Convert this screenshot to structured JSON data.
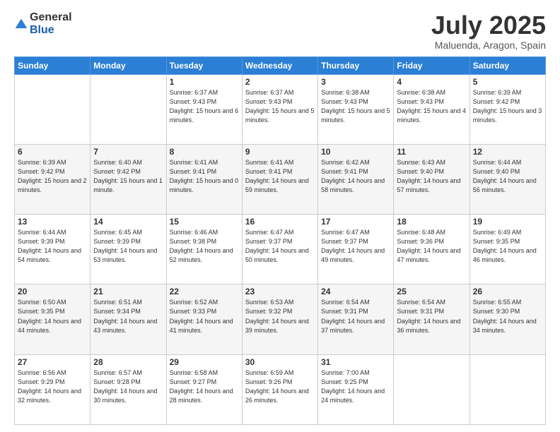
{
  "logo": {
    "general": "General",
    "blue": "Blue"
  },
  "header": {
    "month": "July 2025",
    "location": "Maluenda, Aragon, Spain"
  },
  "weekdays": [
    "Sunday",
    "Monday",
    "Tuesday",
    "Wednesday",
    "Thursday",
    "Friday",
    "Saturday"
  ],
  "weeks": [
    [
      {
        "day": "",
        "content": ""
      },
      {
        "day": "",
        "content": ""
      },
      {
        "day": "1",
        "sunrise": "Sunrise: 6:37 AM",
        "sunset": "Sunset: 9:43 PM",
        "daylight": "Daylight: 15 hours and 6 minutes."
      },
      {
        "day": "2",
        "sunrise": "Sunrise: 6:37 AM",
        "sunset": "Sunset: 9:43 PM",
        "daylight": "Daylight: 15 hours and 5 minutes."
      },
      {
        "day": "3",
        "sunrise": "Sunrise: 6:38 AM",
        "sunset": "Sunset: 9:43 PM",
        "daylight": "Daylight: 15 hours and 5 minutes."
      },
      {
        "day": "4",
        "sunrise": "Sunrise: 6:38 AM",
        "sunset": "Sunset: 9:43 PM",
        "daylight": "Daylight: 15 hours and 4 minutes."
      },
      {
        "day": "5",
        "sunrise": "Sunrise: 6:39 AM",
        "sunset": "Sunset: 9:42 PM",
        "daylight": "Daylight: 15 hours and 3 minutes."
      }
    ],
    [
      {
        "day": "6",
        "sunrise": "Sunrise: 6:39 AM",
        "sunset": "Sunset: 9:42 PM",
        "daylight": "Daylight: 15 hours and 2 minutes."
      },
      {
        "day": "7",
        "sunrise": "Sunrise: 6:40 AM",
        "sunset": "Sunset: 9:42 PM",
        "daylight": "Daylight: 15 hours and 1 minute."
      },
      {
        "day": "8",
        "sunrise": "Sunrise: 6:41 AM",
        "sunset": "Sunset: 9:41 PM",
        "daylight": "Daylight: 15 hours and 0 minutes."
      },
      {
        "day": "9",
        "sunrise": "Sunrise: 6:41 AM",
        "sunset": "Sunset: 9:41 PM",
        "daylight": "Daylight: 14 hours and 59 minutes."
      },
      {
        "day": "10",
        "sunrise": "Sunrise: 6:42 AM",
        "sunset": "Sunset: 9:41 PM",
        "daylight": "Daylight: 14 hours and 58 minutes."
      },
      {
        "day": "11",
        "sunrise": "Sunrise: 6:43 AM",
        "sunset": "Sunset: 9:40 PM",
        "daylight": "Daylight: 14 hours and 57 minutes."
      },
      {
        "day": "12",
        "sunrise": "Sunrise: 6:44 AM",
        "sunset": "Sunset: 9:40 PM",
        "daylight": "Daylight: 14 hours and 56 minutes."
      }
    ],
    [
      {
        "day": "13",
        "sunrise": "Sunrise: 6:44 AM",
        "sunset": "Sunset: 9:39 PM",
        "daylight": "Daylight: 14 hours and 54 minutes."
      },
      {
        "day": "14",
        "sunrise": "Sunrise: 6:45 AM",
        "sunset": "Sunset: 9:39 PM",
        "daylight": "Daylight: 14 hours and 53 minutes."
      },
      {
        "day": "15",
        "sunrise": "Sunrise: 6:46 AM",
        "sunset": "Sunset: 9:38 PM",
        "daylight": "Daylight: 14 hours and 52 minutes."
      },
      {
        "day": "16",
        "sunrise": "Sunrise: 6:47 AM",
        "sunset": "Sunset: 9:37 PM",
        "daylight": "Daylight: 14 hours and 50 minutes."
      },
      {
        "day": "17",
        "sunrise": "Sunrise: 6:47 AM",
        "sunset": "Sunset: 9:37 PM",
        "daylight": "Daylight: 14 hours and 49 minutes."
      },
      {
        "day": "18",
        "sunrise": "Sunrise: 6:48 AM",
        "sunset": "Sunset: 9:36 PM",
        "daylight": "Daylight: 14 hours and 47 minutes."
      },
      {
        "day": "19",
        "sunrise": "Sunrise: 6:49 AM",
        "sunset": "Sunset: 9:35 PM",
        "daylight": "Daylight: 14 hours and 46 minutes."
      }
    ],
    [
      {
        "day": "20",
        "sunrise": "Sunrise: 6:50 AM",
        "sunset": "Sunset: 9:35 PM",
        "daylight": "Daylight: 14 hours and 44 minutes."
      },
      {
        "day": "21",
        "sunrise": "Sunrise: 6:51 AM",
        "sunset": "Sunset: 9:34 PM",
        "daylight": "Daylight: 14 hours and 43 minutes."
      },
      {
        "day": "22",
        "sunrise": "Sunrise: 6:52 AM",
        "sunset": "Sunset: 9:33 PM",
        "daylight": "Daylight: 14 hours and 41 minutes."
      },
      {
        "day": "23",
        "sunrise": "Sunrise: 6:53 AM",
        "sunset": "Sunset: 9:32 PM",
        "daylight": "Daylight: 14 hours and 39 minutes."
      },
      {
        "day": "24",
        "sunrise": "Sunrise: 6:54 AM",
        "sunset": "Sunset: 9:31 PM",
        "daylight": "Daylight: 14 hours and 37 minutes."
      },
      {
        "day": "25",
        "sunrise": "Sunrise: 6:54 AM",
        "sunset": "Sunset: 9:31 PM",
        "daylight": "Daylight: 14 hours and 36 minutes."
      },
      {
        "day": "26",
        "sunrise": "Sunrise: 6:55 AM",
        "sunset": "Sunset: 9:30 PM",
        "daylight": "Daylight: 14 hours and 34 minutes."
      }
    ],
    [
      {
        "day": "27",
        "sunrise": "Sunrise: 6:56 AM",
        "sunset": "Sunset: 9:29 PM",
        "daylight": "Daylight: 14 hours and 32 minutes."
      },
      {
        "day": "28",
        "sunrise": "Sunrise: 6:57 AM",
        "sunset": "Sunset: 9:28 PM",
        "daylight": "Daylight: 14 hours and 30 minutes."
      },
      {
        "day": "29",
        "sunrise": "Sunrise: 6:58 AM",
        "sunset": "Sunset: 9:27 PM",
        "daylight": "Daylight: 14 hours and 28 minutes."
      },
      {
        "day": "30",
        "sunrise": "Sunrise: 6:59 AM",
        "sunset": "Sunset: 9:26 PM",
        "daylight": "Daylight: 14 hours and 26 minutes."
      },
      {
        "day": "31",
        "sunrise": "Sunrise: 7:00 AM",
        "sunset": "Sunset: 9:25 PM",
        "daylight": "Daylight: 14 hours and 24 minutes."
      },
      {
        "day": "",
        "content": ""
      },
      {
        "day": "",
        "content": ""
      }
    ]
  ]
}
